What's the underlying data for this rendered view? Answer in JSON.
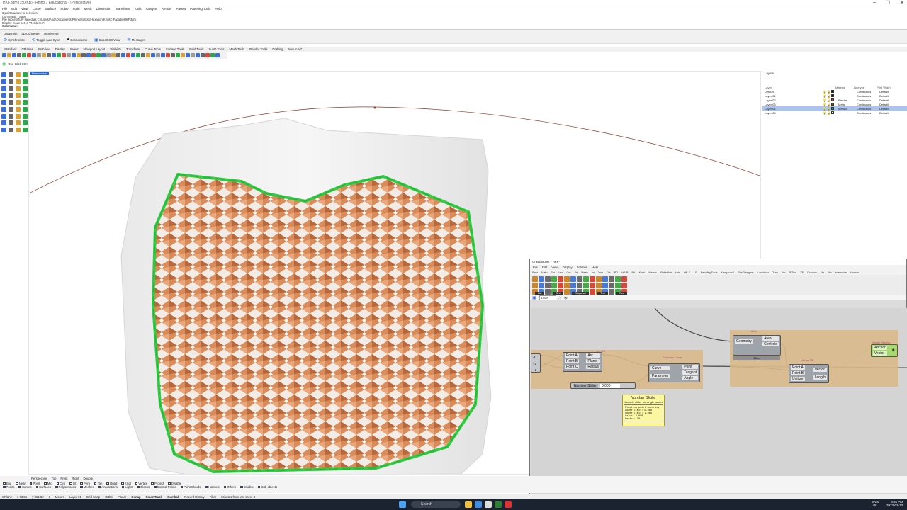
{
  "window_title": "HKF.3dm (150 KB) - Rhino 7 Educational - [Perspective]",
  "menu": [
    "File",
    "Edit",
    "View",
    "Curve",
    "Surface",
    "SubD",
    "Solid",
    "Mesh",
    "Dimension",
    "Transform",
    "Tools",
    "Analyze",
    "Render",
    "Panels",
    "Paneling Tools",
    "Help"
  ],
  "command_history": [
    "3 points added to selection.",
    "Command: _Save",
    "File successfully saved as C:\\Users\\Andi\\Documents\\Rhino\\Scripts\\Hexagon Kinetic Facade\\HKF.3dm.",
    "Display mode set to \"Rendered\".",
    "Command:"
  ],
  "ribbon_tabs": [
    "Datasmith",
    "3D Converter",
    "Omniverse"
  ],
  "ribbon_tools": [
    "Synchronize",
    "Toggle Auto Sync",
    "Connections",
    "Export 3D View",
    "Messages"
  ],
  "toolbar_tabs": [
    "Standard",
    "CPlanes",
    "Set View",
    "Display",
    "Select",
    "Viewport Layout",
    "Visibility",
    "Transform",
    "Curve Tools",
    "Surface Tools",
    "Solid Tools",
    "SubD Tools",
    "Mesh Tools",
    "Render Tools",
    "Drafting",
    "New in V7"
  ],
  "plugin_label": "One Click LCA",
  "viewport_label": "Perspective",
  "view_tabs": [
    "Perspective",
    "Top",
    "Front",
    "Right",
    "Double"
  ],
  "layers": {
    "panel_title": "Layers",
    "columns": [
      "Layer",
      "Material",
      "Linetype",
      "Print Width"
    ],
    "rows": [
      {
        "name": "Default",
        "material": "",
        "linetype": "Continuous",
        "width": "Default",
        "color": "#111111",
        "selected": false
      },
      {
        "name": "Layer 01",
        "material": "",
        "linetype": "Continuous",
        "width": "Default",
        "color": "#111111",
        "selected": false
      },
      {
        "name": "Layer 02",
        "material": "Plaster",
        "linetype": "Continuous",
        "width": "Default",
        "color": "#c0392b",
        "selected": false
      },
      {
        "name": "Layer 03",
        "material": "Metal",
        "linetype": "Continuous",
        "width": "Default",
        "color": "#7b4a2a",
        "selected": false
      },
      {
        "name": "Layer 04",
        "material": "Metal3",
        "linetype": "Continuous",
        "width": "Default",
        "color": "#2aa84a",
        "selected": true
      },
      {
        "name": "Layer 05",
        "material": "",
        "linetype": "Continuous",
        "width": "Default",
        "color": "#ffffff",
        "selected": false
      }
    ]
  },
  "grasshopper": {
    "title": "Grasshopper - HKF*",
    "menu": [
      "File",
      "Edit",
      "View",
      "Display",
      "Solution",
      "Help"
    ],
    "tabs": [
      "Para",
      "Math",
      "Set",
      "Vec",
      "Crv",
      "Srf",
      "Mesh",
      "Int",
      "Trns",
      "Dis",
      "PO",
      "HB-R",
      "PK",
      "Kunk",
      "Weav+",
      "Pufferfish",
      "Hde",
      "HB-E",
      "LB",
      "PanelingTools",
      "Kangaroo2",
      "SkinDesigner",
      "Lunchbox",
      "Tran",
      "Arc",
      "RGlue",
      "ZF",
      "Octopus",
      "Vis",
      "Mb",
      "Intersolve",
      "Human"
    ],
    "comp_groups": [
      "List",
      "Sets",
      "Sequence",
      "Text",
      "Tree"
    ],
    "zoom": "100%",
    "status": "Autosave complete (24 seconds ago)",
    "groups": [
      "Arc 3Pt",
      "Evaluate Curve",
      "Area",
      "Vector 2Pt",
      "Vector Display"
    ],
    "nodes": {
      "arc": {
        "inputs": [
          "Point A",
          "Point B",
          "Point C"
        ],
        "outputs": [
          "Arc",
          "Plane",
          "Radius"
        ]
      },
      "evaluate": {
        "inputs": [
          "Curve",
          "Parameter"
        ],
        "outputs": [
          "Point",
          "Tangent",
          "Angle"
        ]
      },
      "area": {
        "inputs": [
          "Geometry"
        ],
        "outputs": [
          "Area",
          "Centroid"
        ],
        "footer": "32ms"
      },
      "vector": {
        "inputs": [
          "Point A",
          "Point B",
          "Unitize"
        ],
        "outputs": [
          "Vector",
          "Length"
        ]
      },
      "display": {
        "inputs": [
          "Anchor",
          "Vector"
        ]
      }
    },
    "panel_values": [
      "-1",
      "+1",
      "+2"
    ],
    "slider": {
      "label": "Number Slider",
      "value": "0.000"
    },
    "tooltip": {
      "title": "Number Slider",
      "subtitle": "Numeric slider for single values",
      "lines": [
        "Floating point accuracy",
        "Lower limit: 0.000",
        "Upper limit: 1.000",
        "Value: 0.000",
        "Factor: 38"
      ]
    }
  },
  "status_views": [
    "Perspective",
    "Top",
    "Front",
    "Right",
    "Double"
  ],
  "osnaps": [
    {
      "label": "End",
      "on": false
    },
    {
      "label": "Near",
      "on": false
    },
    {
      "label": "Point",
      "on": true
    },
    {
      "label": "Mid",
      "on": false
    },
    {
      "label": "Cen",
      "on": false
    },
    {
      "label": "Int",
      "on": false
    },
    {
      "label": "Perp",
      "on": false
    },
    {
      "label": "Tan",
      "on": false
    },
    {
      "label": "Quad",
      "on": false
    },
    {
      "label": "Knot",
      "on": false
    },
    {
      "label": "Vertex",
      "on": false
    },
    {
      "label": "Project",
      "on": false
    },
    {
      "label": "Disable",
      "on": false
    }
  ],
  "filters": [
    "Points",
    "Curves",
    "Surfaces",
    "Polysurfaces",
    "Meshes",
    "Annotations",
    "Lights",
    "Blocks",
    "Control Points",
    "Point Clouds",
    "Hatches",
    "Others",
    "Disable",
    "Sub-objects"
  ],
  "statusbar": [
    "CPlane",
    "x 73.56",
    "y 361.52",
    "z",
    "Meters",
    "Layer 01",
    "Grid Snap",
    "Ortho",
    "Planar",
    "Osnap",
    "SmartTrack",
    "Gumball",
    "Record History",
    "Filter",
    "Minutes from last save: 4"
  ],
  "taskbar": {
    "search": "Search",
    "lang": "ENG\nUS",
    "time": "8:55 PM",
    "date": "2023-02-13"
  }
}
